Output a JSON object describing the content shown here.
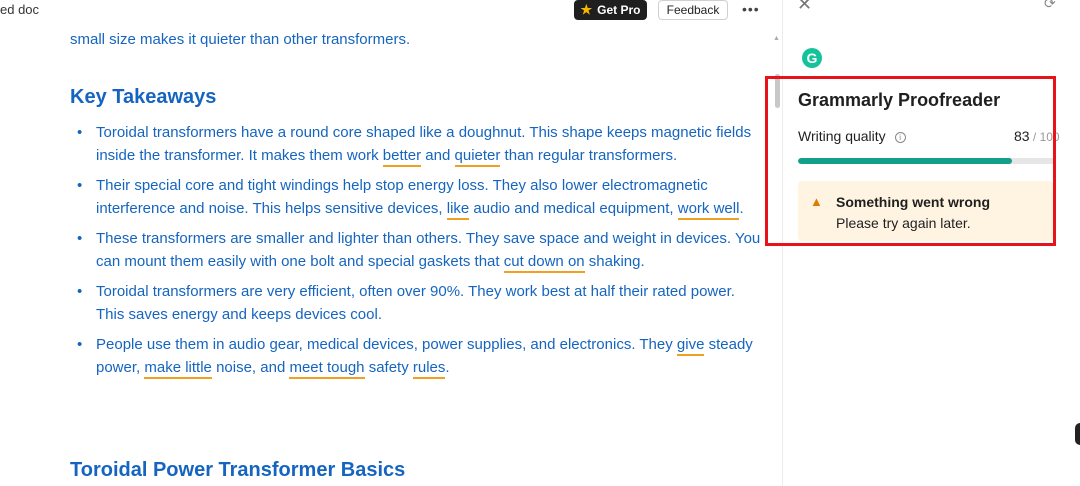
{
  "top_bar": {
    "doc_title": "ed doc",
    "get_pro_label": "Get Pro",
    "feedback_label": "Feedback",
    "more_label": "•••"
  },
  "document": {
    "intro_text": "small size makes it quieter than other transformers.",
    "heading_1": "Key Takeaways",
    "bullets": [
      {
        "t1": "Toroidal transformers have a round core shaped like a doughnut. This shape keeps magnetic fields inside the transformer. It makes them work ",
        "u1": "better",
        "t2": " and ",
        "u2": "quieter",
        "t3": " than regular transformers."
      },
      {
        "t1": "Their special core and tight windings help stop energy loss. They also lower electromagnetic interference and noise. This helps sensitive devices, ",
        "u1": "like",
        "t2": " audio and medical equipment, ",
        "u2": "work well",
        "t3": "."
      },
      {
        "t1": "These transformers are smaller and lighter than others. They save space and weight in devices. You can mount them easily with one bolt and special gaskets that ",
        "u1": "cut down on",
        "t2": " shaking."
      },
      {
        "t1": "Toroidal transformers are very efficient, often over 90%. They work best at half their rated power. This saves energy and keeps devices cool."
      },
      {
        "t1": "People use them in audio gear, medical devices, power supplies, and electronics. They ",
        "u1": "give",
        "t2": " steady power, ",
        "u2": "make little",
        "t3": " noise, and ",
        "u3": "meet tough",
        "t4": " safety ",
        "u4": "rules",
        "t5": "."
      }
    ],
    "heading_2": "Toroidal Power Transformer Basics"
  },
  "grammarly": {
    "logo_letter": "G",
    "title": "Grammarly Proofreader",
    "writing_quality_label": "Writing quality",
    "score": "83",
    "score_max": " / 100",
    "score_fraction": 0.83,
    "alert_title": "Something went wrong",
    "alert_message": "Please try again later."
  },
  "colors": {
    "link_blue": "#1565c0",
    "underline_orange": "#f0a020",
    "progress_green": "#12a08a",
    "highlight_red": "#e8131a",
    "alert_bg": "#fef4e1"
  }
}
